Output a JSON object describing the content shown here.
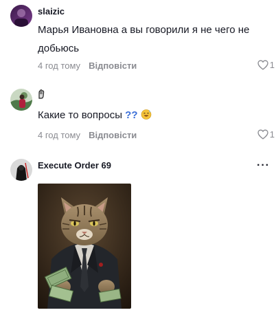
{
  "comments": [
    {
      "username": "slaizic",
      "avatar_icon": "purple-avatar-icon",
      "text": "Марья Ивановна а вы говорили я не чего не добьюсь",
      "time": "4 год тому",
      "reply_label": "Відповісти",
      "likes": "1"
    },
    {
      "username": "",
      "username_icon": "hand-emoji-icon",
      "avatar_icon": "green-avatar-icon",
      "text": "Какие то вопросы",
      "text_emoji": "??",
      "time": "4 год тому",
      "reply_label": "Відповісти",
      "likes": "1"
    },
    {
      "username": "Execute Order 69",
      "avatar_icon": "dark-avatar-icon",
      "sticker_icon": "cat-in-suit-sticker",
      "more_label": "···"
    }
  ],
  "colors": {
    "text_primary": "#161823",
    "text_secondary": "#8a8b91",
    "background": "#ffffff"
  }
}
